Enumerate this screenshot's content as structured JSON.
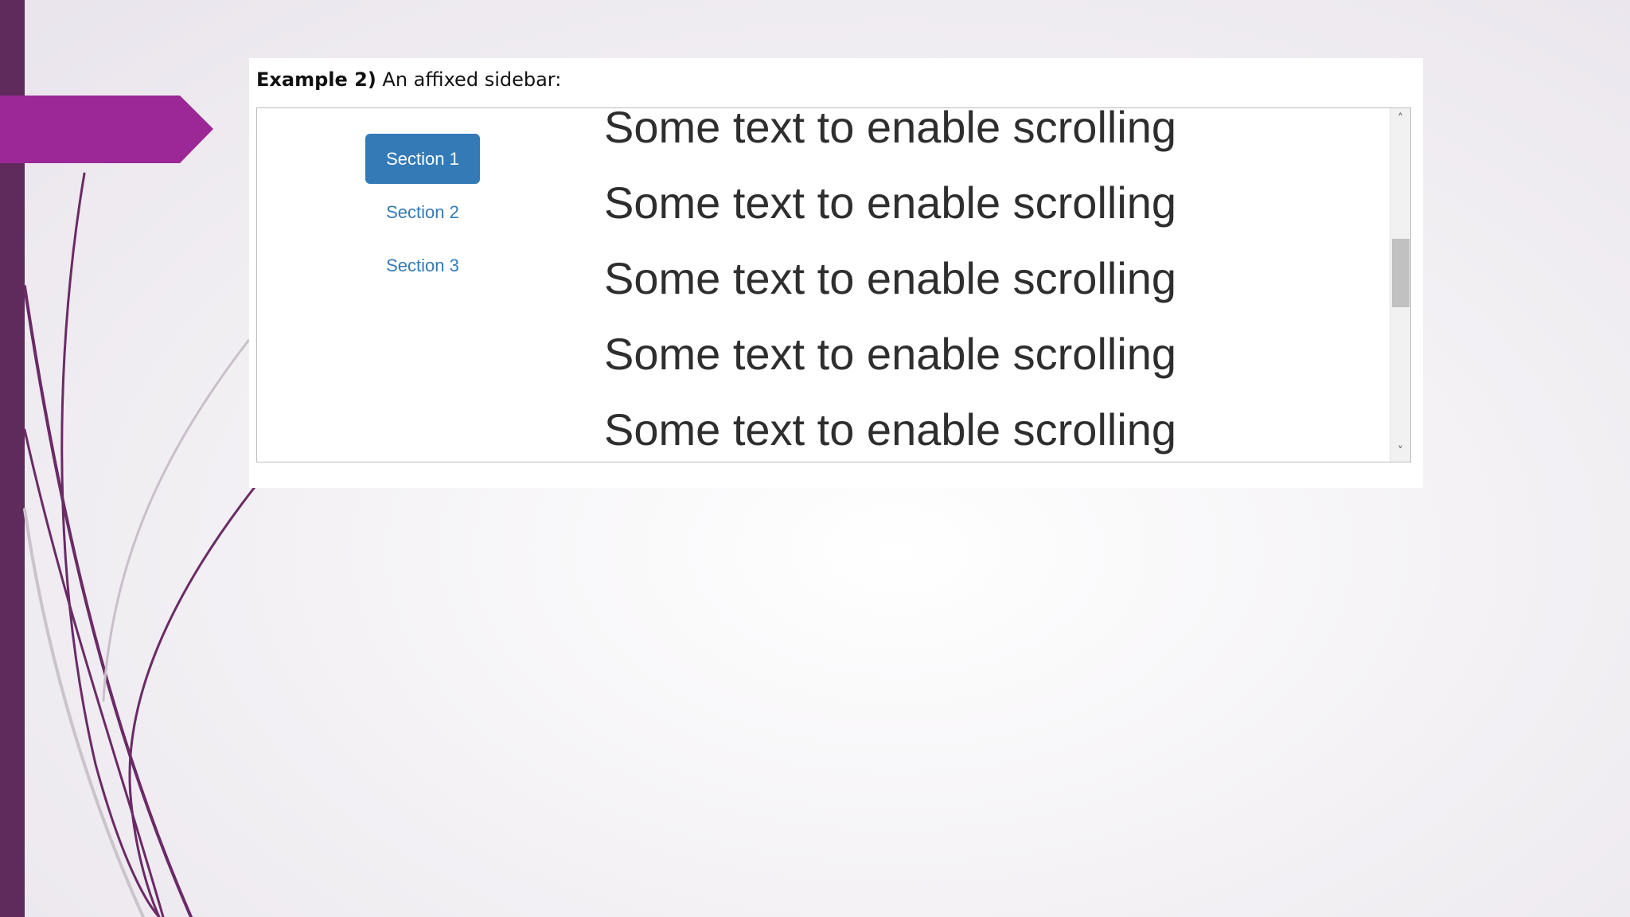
{
  "slide": {
    "accent_color": "#9b2896",
    "bar_color": "#5f2a5c"
  },
  "example": {
    "heading_bold": "Example 2)",
    "heading_rest": " An affixed sidebar:"
  },
  "sidebar": {
    "items": [
      {
        "label": "Section 1",
        "active": true
      },
      {
        "label": "Section 2",
        "active": false
      },
      {
        "label": "Section 3",
        "active": false
      }
    ]
  },
  "content": {
    "lines": [
      "Some text to enable scrolling",
      "Some text to enable scrolling",
      "Some text to enable scrolling",
      "Some text to enable scrolling",
      "Some text to enable scrolling"
    ]
  },
  "scrollbar": {
    "up_icon": "chevron-up-icon",
    "down_icon": "chevron-down-icon",
    "up_glyph": "˄",
    "down_glyph": "˅"
  }
}
